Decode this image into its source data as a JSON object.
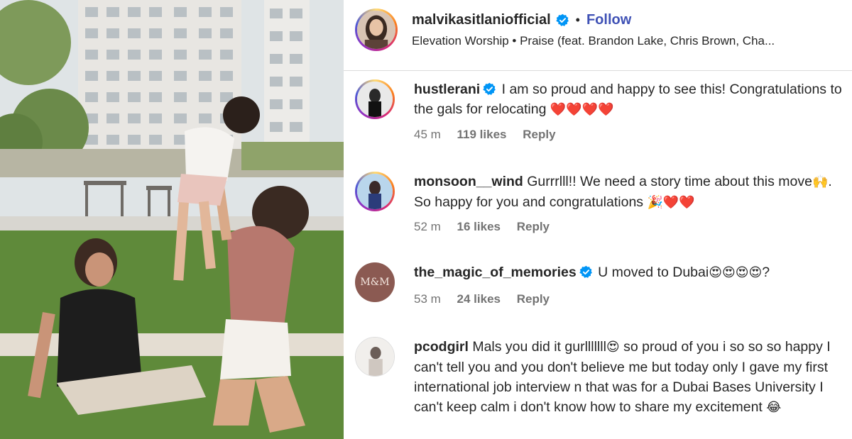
{
  "post": {
    "username": "malvikasitlaniofficial",
    "separator": "•",
    "follow_label": "Follow",
    "audio": "Elevation Worship • Praise (feat. Brandon Lake, Chris Brown, Cha..."
  },
  "comments": [
    {
      "username": "hustlerani",
      "verified": true,
      "text": "I am so proud and happy to see this! Congratulations to the gals for relocating",
      "emoji": "❤️❤️❤️❤️",
      "time": "45 m",
      "likes": "119 likes",
      "reply": "Reply"
    },
    {
      "username": "monsoon__wind",
      "verified": false,
      "text_a": "Gurrrlll!! We need a story time about this move",
      "emoji_a": "🙌",
      "text_b": ". So happy for you and congratulations",
      "emoji_b": "🎉❤️❤️",
      "time": "52 m",
      "likes": "16 likes",
      "reply": "Reply"
    },
    {
      "username": "the_magic_of_memories",
      "verified": true,
      "avatar_text": "M&M",
      "text": "U moved to Dubai",
      "emoji": "😍😍😍😍",
      "text_end": "?",
      "time": "53 m",
      "likes": "24 likes",
      "reply": "Reply"
    },
    {
      "username": "pcodgirl",
      "verified": false,
      "text_a": "Mals you did it gurlllllll",
      "emoji_a": "😍",
      "text_b": " so proud of you i so so so happy I can't tell you and you don't believe me but today only I gave my first international job interview n that was for a Dubai Bases University I can't keep calm i don't know how to share my excitement",
      "emoji_b": "😂"
    }
  ],
  "icons": {
    "verified": "verified-badge-icon",
    "colors": {
      "verified": "#0095f6",
      "follow": "#3f51b5",
      "meta": "#737373"
    }
  }
}
